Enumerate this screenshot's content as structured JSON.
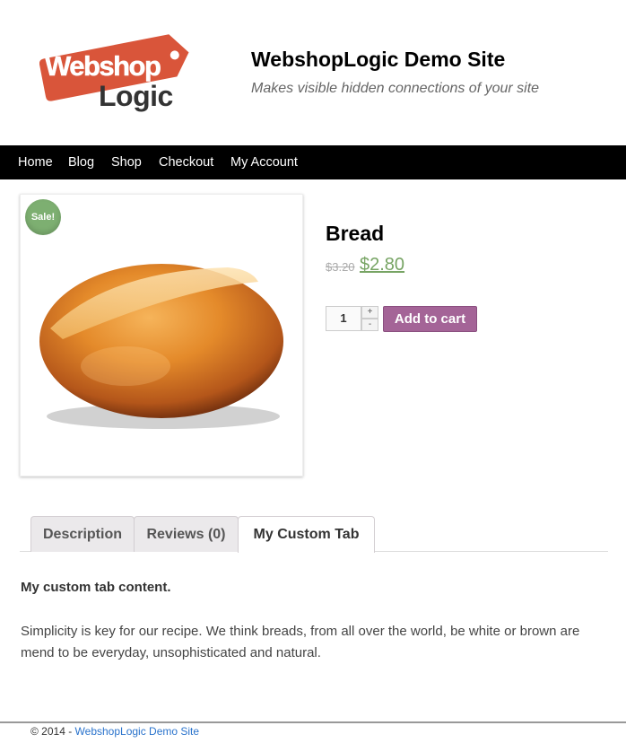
{
  "header": {
    "logo": {
      "line1": "Webshop",
      "line2": "Logic"
    },
    "site_title": "WebshopLogic Demo Site",
    "tagline": "Makes visible hidden connections of your site"
  },
  "nav": {
    "items": [
      {
        "label": "Home"
      },
      {
        "label": "Blog"
      },
      {
        "label": "Shop"
      },
      {
        "label": "Checkout"
      },
      {
        "label": "My Account"
      }
    ]
  },
  "product": {
    "sale_badge": "Sale!",
    "title": "Bread",
    "old_price": "$3.20",
    "new_price": "$2.80",
    "quantity": "1",
    "qty_plus": "+",
    "qty_minus": "-",
    "add_to_cart_label": "Add to cart"
  },
  "tabs": {
    "items": [
      {
        "label": "Description"
      },
      {
        "label": "Reviews (0)"
      },
      {
        "label": "My Custom Tab"
      }
    ],
    "active": "My Custom Tab",
    "content_heading": "My custom tab content.",
    "content_text": "Simplicity is key for our recipe. We think breads, from all over the world, be white or brown are mend to be everyday, unsophisticated and natural."
  },
  "footer": {
    "copyright": "© 2014 - ",
    "site_link": "WebshopLogic Demo Site"
  },
  "colors": {
    "nav_bg": "#000000",
    "logo_tag": "#d9553a",
    "sale_badge": "#7daf71",
    "sale_price": "#77a464",
    "add_to_cart": "#a46497",
    "footer_link": "#2a73cc"
  }
}
